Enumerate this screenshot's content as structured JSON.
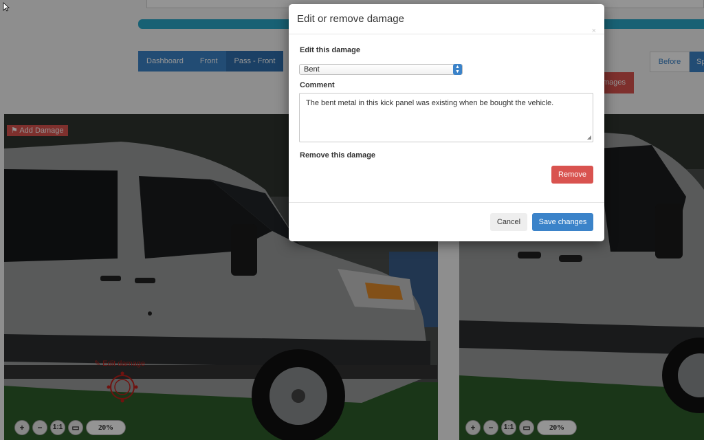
{
  "nav": {
    "tabs": [
      "Dashboard",
      "Front",
      "Pass - Front"
    ],
    "before_label": "Before",
    "sp_label": "Sp",
    "damages_label": "mages"
  },
  "left_panel": {
    "add_damage_label": "Add Damage",
    "edit_damage_label": "Edit damage",
    "zoom": {
      "plus": "+",
      "minus": "−",
      "one_to_one": "1:1",
      "zoom_value": "20%"
    }
  },
  "right_panel": {
    "zoom": {
      "plus": "+",
      "minus": "−",
      "one_to_one": "1:1",
      "zoom_value": "20%"
    }
  },
  "modal": {
    "title": "Edit or remove damage",
    "close": "×",
    "edit_label": "Edit this damage",
    "damage_type": "Bent",
    "comment_label": "Comment",
    "comment_text": "The bent metal in this kick panel was existing when be bought the vehicle.",
    "remove_section_label": "Remove this damage",
    "remove_button": "Remove",
    "cancel_button": "Cancel",
    "save_button": "Save changes"
  },
  "colors": {
    "primary": "#3b83c9",
    "danger": "#d9534f",
    "info": "#2aa7c9"
  }
}
